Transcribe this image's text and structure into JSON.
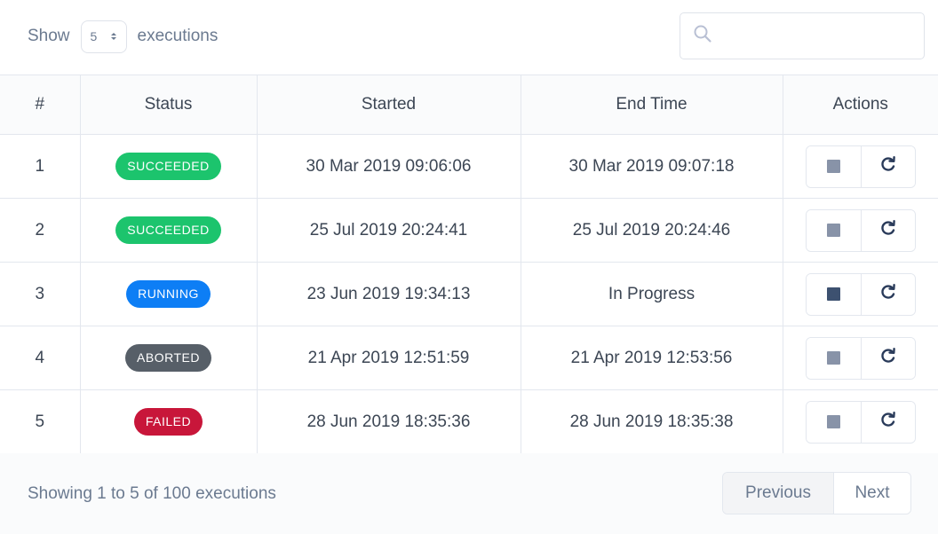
{
  "toolbar": {
    "show_label": "Show",
    "page_size": "5",
    "entity_label": "executions",
    "search_value": "",
    "search_placeholder": ""
  },
  "table": {
    "headers": [
      "#",
      "Status",
      "Started",
      "End Time",
      "Actions"
    ],
    "rows": [
      {
        "num": "1",
        "status": "SUCCEEDED",
        "started": "30 Mar 2019 09:06:06",
        "end": "30 Mar 2019 09:07:18",
        "stop_active": false
      },
      {
        "num": "2",
        "status": "SUCCEEDED",
        "started": "25 Jul 2019 20:24:41",
        "end": "25 Jul 2019 20:24:46",
        "stop_active": false
      },
      {
        "num": "3",
        "status": "RUNNING",
        "started": "23 Jun 2019 19:34:13",
        "end": "In Progress",
        "stop_active": true
      },
      {
        "num": "4",
        "status": "ABORTED",
        "started": "21 Apr 2019 12:51:59",
        "end": "21 Apr 2019 12:53:56",
        "stop_active": false
      },
      {
        "num": "5",
        "status": "FAILED",
        "started": "28 Jun 2019 18:35:36",
        "end": "28 Jun 2019 18:35:38",
        "stop_active": false
      }
    ],
    "action_icons": [
      "stop-icon",
      "rerun-icon"
    ]
  },
  "status_colors": {
    "SUCCEEDED": "#1cc46d",
    "RUNNING": "#0d7ef5",
    "ABORTED": "#575f68",
    "FAILED": "#c8163a"
  },
  "icon_colors": {
    "stop_disabled": "#8893a8",
    "stop_active": "#3d5170",
    "rerun": "#2a3b5a"
  },
  "footer": {
    "summary": "Showing 1 to 5 of 100 executions",
    "previous_label": "Previous",
    "next_label": "Next"
  }
}
